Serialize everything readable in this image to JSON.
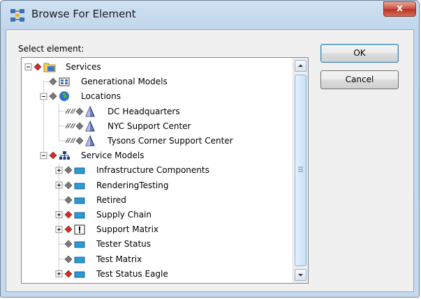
{
  "window": {
    "title": "Browse For Element",
    "close_glyph": "x"
  },
  "dialog": {
    "prompt": "Select element:",
    "ok_label": "OK",
    "cancel_label": "Cancel"
  },
  "tree": {
    "root": {
      "label": "Services",
      "icon": "services-folder-icon",
      "expanded": true
    },
    "items": [
      {
        "label": "Generational Models",
        "icon": "table-icon"
      },
      {
        "label": "Locations",
        "icon": "globe-icon",
        "expanded": true
      },
      {
        "label": "DC Headquarters",
        "icon": "location-triangle-icon"
      },
      {
        "label": "NYC Support Center",
        "icon": "location-triangle-icon"
      },
      {
        "label": "Tysons Corner Support Center",
        "icon": "location-triangle-icon"
      },
      {
        "label": "Service Models",
        "icon": "hierarchy-icon",
        "expanded": true
      },
      {
        "label": "Infrastructure Components",
        "icon": "model-icon",
        "collapsed": true
      },
      {
        "label": "RenderingTesting",
        "icon": "model-icon",
        "collapsed": true
      },
      {
        "label": "Retired",
        "icon": "model-icon"
      },
      {
        "label": "Supply Chain",
        "icon": "model-icon",
        "collapsed": true
      },
      {
        "label": "Support Matrix",
        "icon": "alert-box-icon",
        "collapsed": true
      },
      {
        "label": "Tester Status",
        "icon": "model-icon"
      },
      {
        "label": "Test Matrix",
        "icon": "model-icon"
      },
      {
        "label": "Test Status Eagle",
        "icon": "model-icon",
        "collapsed": true
      }
    ]
  },
  "colors": {
    "red_diamond": "#e0271f",
    "gray_diamond": "#7a7a7a",
    "model_blue": "#2a9bd6"
  }
}
